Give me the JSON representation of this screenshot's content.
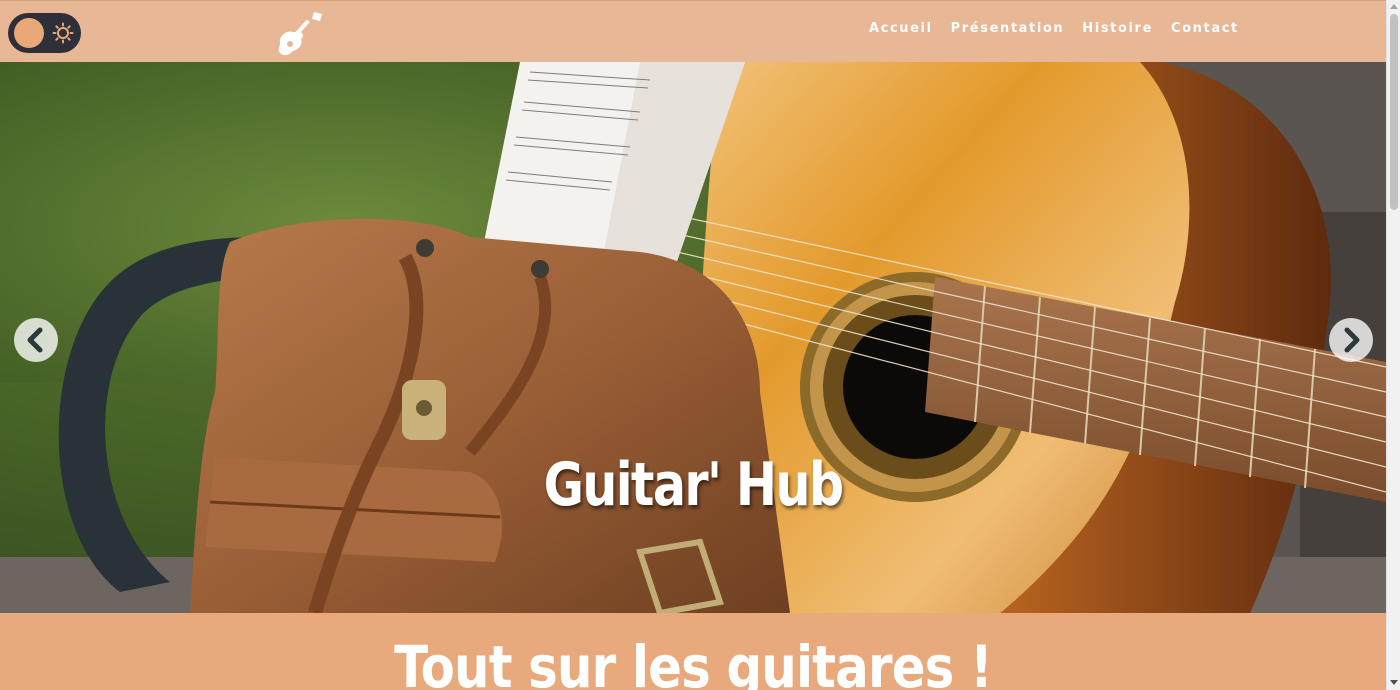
{
  "header": {
    "nav": [
      {
        "label": "Accueil"
      },
      {
        "label": "Présentation"
      },
      {
        "label": "Histoire"
      },
      {
        "label": "Contact"
      }
    ],
    "logo_icon": "guitar-icon",
    "theme_toggle_icon": "sun-icon"
  },
  "hero": {
    "title": "Guitar' Hub",
    "prev_icon": "chevron-left-icon",
    "next_icon": "chevron-right-icon"
  },
  "band": {
    "title": "Tout sur les guitares !"
  },
  "colors": {
    "header_bg": "#e8b795",
    "band_bg": "#e8aa7c",
    "toggle_bg": "#2f2f3a",
    "toggle_knob": "#e8a878",
    "text": "#ffffff"
  }
}
